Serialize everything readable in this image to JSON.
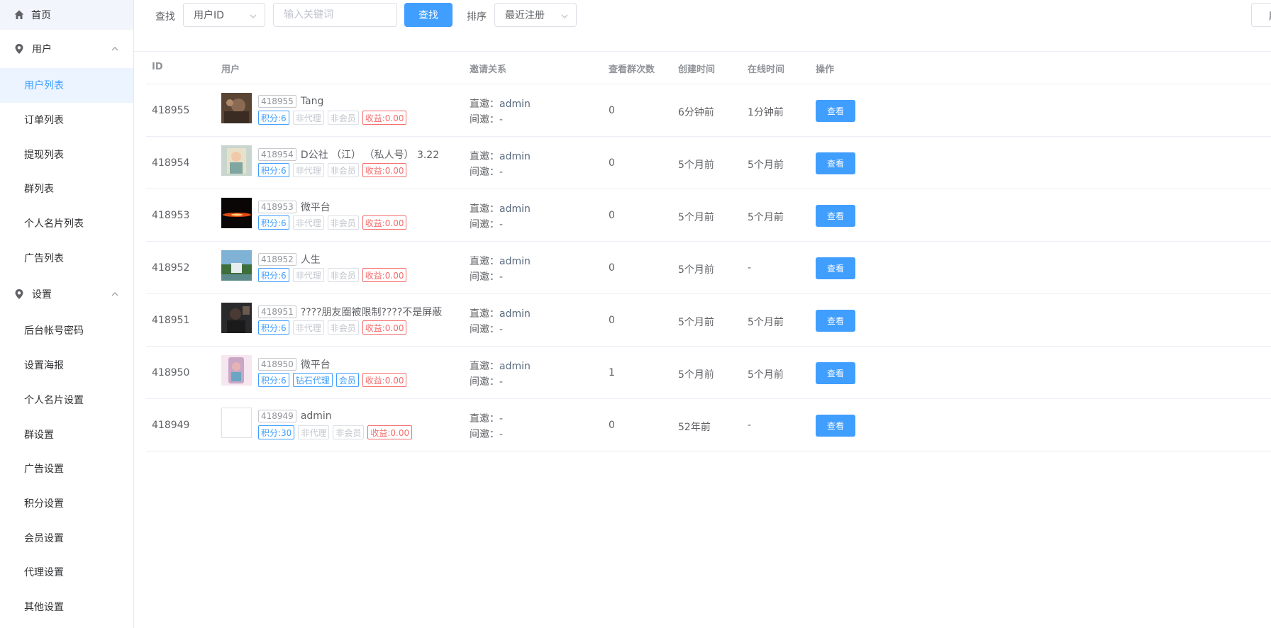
{
  "sidebar": {
    "home_label": "首页",
    "groups": [
      {
        "title": "用户",
        "items": [
          "用户列表",
          "订单列表",
          "提现列表",
          "群列表",
          "个人名片列表",
          "广告列表"
        ]
      },
      {
        "title": "设置",
        "items": [
          "后台帐号密码",
          "设置海报",
          "个人名片设置",
          "群设置",
          "广告设置",
          "积分设置",
          "会员设置",
          "代理设置",
          "其他设置"
        ]
      }
    ]
  },
  "toolbar": {
    "search_label": "查找",
    "field_select_value": "用户ID",
    "keyword_placeholder": "输入关键词",
    "search_button": "查找",
    "sort_label": "排序",
    "sort_select_value": "最近注册",
    "right_button_partial": "刷"
  },
  "table": {
    "headers": {
      "id": "ID",
      "user": "用户",
      "invite": "邀请关系",
      "views": "查看群次数",
      "created": "创建时间",
      "online": "在线时间",
      "actions": "操作"
    },
    "invite_direct_label": "直邀：",
    "invite_indirect_label": "间邀：",
    "view_button": "查看",
    "rows": [
      {
        "id": "418955",
        "uid_tag": "418955",
        "name": "Tang",
        "tags": [
          {
            "text": "积分:6",
            "color": "blue"
          },
          {
            "text": "非代理",
            "color": "gray"
          },
          {
            "text": "非会员",
            "color": "gray"
          },
          {
            "text": "收益:0.00",
            "color": "red"
          }
        ],
        "direct": "admin",
        "indirect": "-",
        "views": "0",
        "created": "6分钟前",
        "online": "1分钟前",
        "avatar": "photo-dark"
      },
      {
        "id": "418954",
        "uid_tag": "418954",
        "name": "D公社 （江） （私人号） 3.22",
        "tags": [
          {
            "text": "积分:6",
            "color": "blue"
          },
          {
            "text": "非代理",
            "color": "gray"
          },
          {
            "text": "非会员",
            "color": "gray"
          },
          {
            "text": "收益:0.00",
            "color": "red"
          }
        ],
        "direct": "admin",
        "indirect": "-",
        "views": "0",
        "created": "5个月前",
        "online": "5个月前",
        "avatar": "photo-light"
      },
      {
        "id": "418953",
        "uid_tag": "418953",
        "name": "微平台",
        "tags": [
          {
            "text": "积分:6",
            "color": "blue"
          },
          {
            "text": "非代理",
            "color": "gray"
          },
          {
            "text": "非会员",
            "color": "gray"
          },
          {
            "text": "收益:0.00",
            "color": "red"
          }
        ],
        "direct": "admin",
        "indirect": "-",
        "views": "0",
        "created": "5个月前",
        "online": "5个月前",
        "avatar": "photo-flare"
      },
      {
        "id": "418952",
        "uid_tag": "418952",
        "name": "人生",
        "tags": [
          {
            "text": "积分:6",
            "color": "blue"
          },
          {
            "text": "非代理",
            "color": "gray"
          },
          {
            "text": "非会员",
            "color": "gray"
          },
          {
            "text": "收益:0.00",
            "color": "red"
          }
        ],
        "direct": "admin",
        "indirect": "-",
        "views": "0",
        "created": "5个月前",
        "online": "-",
        "avatar": "photo-landscape"
      },
      {
        "id": "418951",
        "uid_tag": "418951",
        "name": "????朋友圈被限制????不是屏蔽",
        "tags": [
          {
            "text": "积分:6",
            "color": "blue"
          },
          {
            "text": "非代理",
            "color": "gray"
          },
          {
            "text": "非会员",
            "color": "gray"
          },
          {
            "text": "收益:0.00",
            "color": "red"
          }
        ],
        "direct": "admin",
        "indirect": "-",
        "views": "0",
        "created": "5个月前",
        "online": "5个月前",
        "avatar": "photo-person"
      },
      {
        "id": "418950",
        "uid_tag": "418950",
        "name": "微平台",
        "tags": [
          {
            "text": "积分:6",
            "color": "blue"
          },
          {
            "text": "钻石代理",
            "color": "blue"
          },
          {
            "text": "会员",
            "color": "blue"
          },
          {
            "text": "收益:0.00",
            "color": "red"
          }
        ],
        "direct": "admin",
        "indirect": "-",
        "views": "1",
        "created": "5个月前",
        "online": "5个月前",
        "avatar": "photo-pink"
      },
      {
        "id": "418949",
        "uid_tag": "418949",
        "name": "admin",
        "tags": [
          {
            "text": "积分:30",
            "color": "blue"
          },
          {
            "text": "非代理",
            "color": "gray"
          },
          {
            "text": "非会员",
            "color": "gray"
          },
          {
            "text": "收益:0.00",
            "color": "red"
          }
        ],
        "direct": "-",
        "indirect": "-",
        "views": "0",
        "created": "52年前",
        "online": "-",
        "avatar": "blank"
      }
    ]
  },
  "colors": {
    "primary": "#409eff",
    "active_bg": "#ecf5ff",
    "danger": "#f56c6c",
    "muted": "#c0c4cc"
  }
}
